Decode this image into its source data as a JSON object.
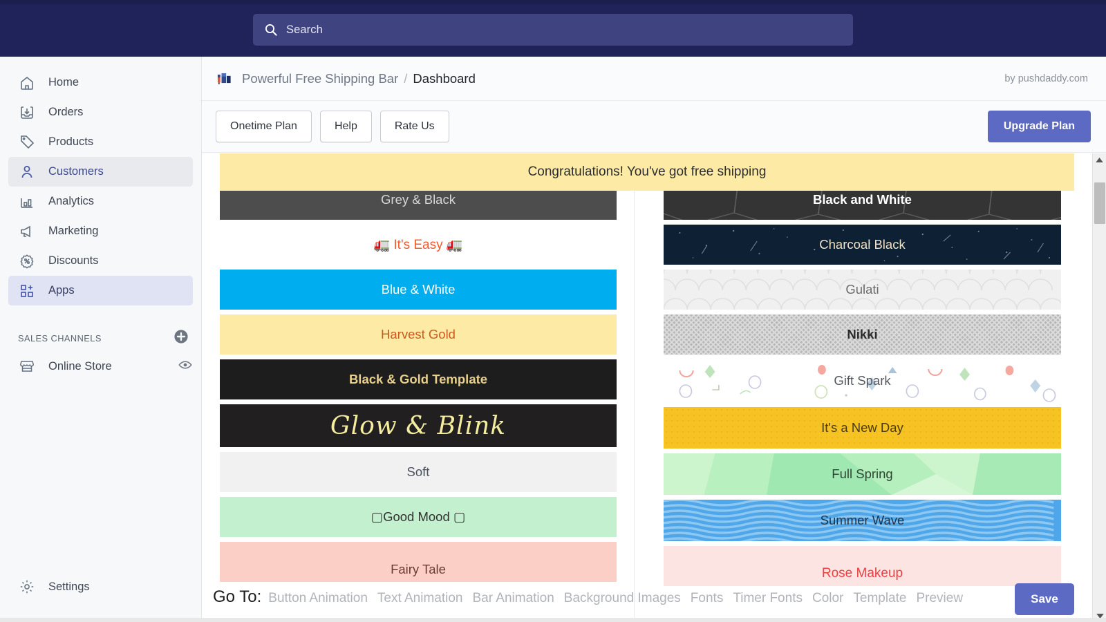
{
  "topbar": {
    "search_placeholder": "Search",
    "search_icon": "search-icon",
    "bg": "#1f2359"
  },
  "sidebar": {
    "items": [
      {
        "label": "Home",
        "icon": "home-icon",
        "state": "normal"
      },
      {
        "label": "Orders",
        "icon": "orders-icon",
        "state": "normal"
      },
      {
        "label": "Products",
        "icon": "products-tag-icon",
        "state": "normal"
      },
      {
        "label": "Customers",
        "icon": "customers-person-icon",
        "state": "hover"
      },
      {
        "label": "Analytics",
        "icon": "analytics-bars-icon",
        "state": "normal"
      },
      {
        "label": "Marketing",
        "icon": "marketing-megaphone-icon",
        "state": "normal"
      },
      {
        "label": "Discounts",
        "icon": "discounts-percent-icon",
        "state": "normal"
      },
      {
        "label": "Apps",
        "icon": "apps-grid-icon",
        "state": "selected"
      }
    ],
    "section_label": "SALES CHANNELS",
    "add_channel_icon": "plus-circle-icon",
    "channels": [
      {
        "label": "Online Store",
        "icon": "store-icon",
        "action_icon": "eye-icon"
      }
    ],
    "settings": {
      "label": "Settings",
      "icon": "gear-icon"
    }
  },
  "header": {
    "app_name": "Powerful Free Shipping Bar",
    "separator": "/",
    "current_page": "Dashboard",
    "by_line": "by pushdaddy.com",
    "logo_icon": "shipping-bar-logo-icon"
  },
  "toolbar": {
    "buttons": [
      "Onetime Plan",
      "Help",
      "Rate Us"
    ],
    "upgrade_label": "Upgrade Plan",
    "upgrade_color": "#5c6ac4"
  },
  "banner": {
    "text": "Congratulations! You've got free shipping",
    "bg": "#fdeba5",
    "color": "#2e2e2e"
  },
  "templates": {
    "left": [
      {
        "name": "Grey & Black",
        "bg": "#4d4d4d",
        "color": "#d6d6d6",
        "style": "solid"
      },
      {
        "name": "🚛 It's Easy 🚛",
        "bg": "#ffffff",
        "color": "#f4592a",
        "style": "solid"
      },
      {
        "name": "Blue & White",
        "bg": "#00aeef",
        "color": "#ffffff",
        "style": "solid"
      },
      {
        "name": "Harvest Gold",
        "bg": "#fdeba5",
        "color": "#c75b20",
        "style": "solid"
      },
      {
        "name": "Black & Gold Template",
        "bg": "#1d1d1d",
        "color": "#e8cf8a",
        "style": "solid"
      },
      {
        "name": "Glow & Blink",
        "bg": "#211f1f",
        "color": "#f4eda0",
        "style": "script"
      },
      {
        "name": "Soft",
        "bg": "#f1f1f1",
        "color": "#4a5160",
        "style": "solid"
      },
      {
        "name": "▢Good Mood ▢",
        "bg": "#c3f0cf",
        "color": "#323232",
        "style": "solid"
      },
      {
        "name": "Fairy Tale",
        "bg": "#fbcfc6",
        "color": "#6b3a33",
        "style": "solid"
      }
    ],
    "right": [
      {
        "name": "Black and White",
        "bg": "#343434",
        "color": "#ffffff",
        "style": "hexpattern"
      },
      {
        "name": "Charcoal Black",
        "bg": "#0e2033",
        "color": "#f0e3c8",
        "style": "stars"
      },
      {
        "name": "Gulati",
        "bg": "#f0f0f0",
        "color": "#6b6b6b",
        "style": "scallops"
      },
      {
        "name": "Nikki",
        "bg": "#b8b8b8",
        "color": "#2b2b2b",
        "style": "crosshatch"
      },
      {
        "name": "Gift Spark",
        "bg": "#ffffff",
        "color": "#55585e",
        "style": "confetti"
      },
      {
        "name": "It's a New Day",
        "bg": "#f6c324",
        "color": "#4a3a10",
        "style": "dots"
      },
      {
        "name": "Full Spring",
        "bg": "#bdf3c6",
        "color": "#2e4634",
        "style": "polygons"
      },
      {
        "name": "Summer Wave",
        "bg": "#4fa6e8",
        "color": "#20364a",
        "style": "waves"
      },
      {
        "name": "Rose Makeup",
        "bg": "#fce4e2",
        "color": "#ef3e3e",
        "style": "solid"
      }
    ]
  },
  "goto": {
    "label": "Go To:",
    "links": [
      "Button Animation",
      "Text Animation",
      "Bar Animation",
      "Background Images",
      "Fonts",
      "Timer Fonts",
      "Color",
      "Template",
      "Preview"
    ]
  },
  "footer": {
    "save_label": "Save",
    "save_color": "#5c6ac4"
  },
  "scrollbar": {
    "up_arrow": "triangle-up-icon",
    "down_arrow": "triangle-down-icon"
  }
}
